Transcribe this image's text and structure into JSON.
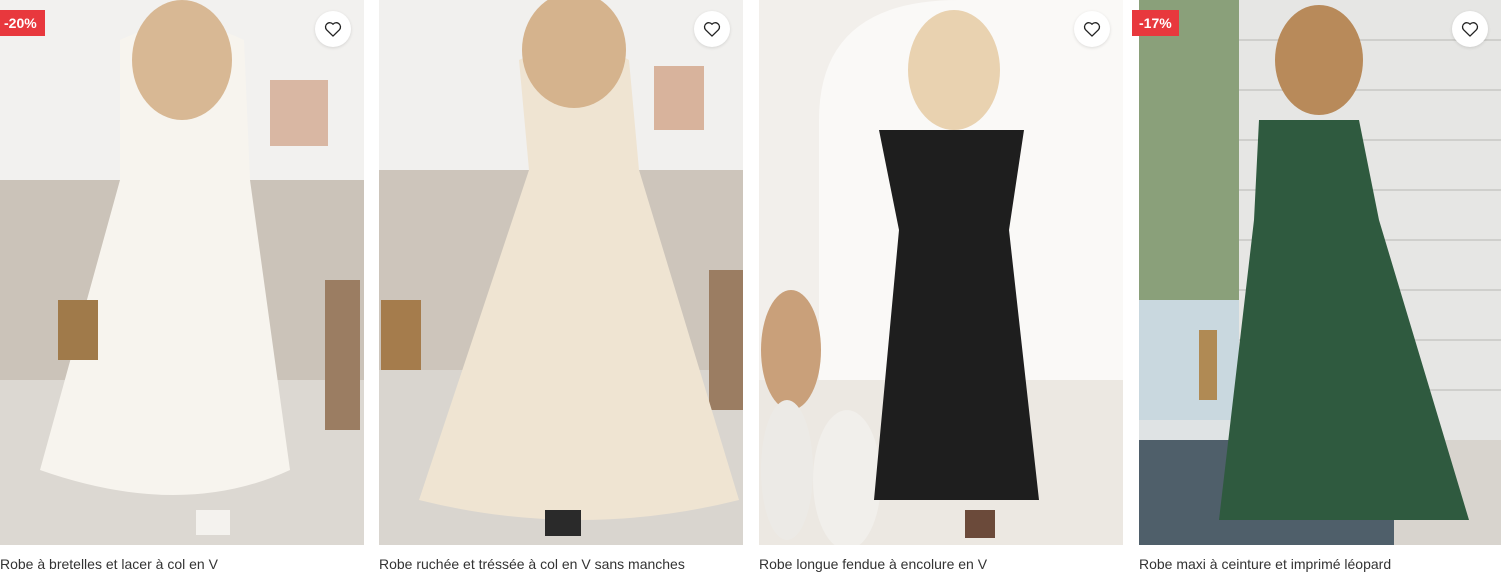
{
  "products": [
    {
      "title": "Robe à bretelles et lacer à col en V",
      "badge": "-20%",
      "wishlist_icon": "heart-outline-icon"
    },
    {
      "title": "Robe ruchée et tréssée à col en V sans manches",
      "badge": "",
      "wishlist_icon": "heart-outline-icon"
    },
    {
      "title": "Robe longue fendue à encolure en V",
      "badge": "",
      "wishlist_icon": "heart-outline-icon"
    },
    {
      "title": "Robe maxi à ceinture et imprimé léopard",
      "badge": "-17%",
      "wishlist_icon": "heart-outline-icon"
    }
  ],
  "colors": {
    "badge_bg": "#e8383d",
    "badge_text": "#ffffff",
    "title_text": "#333333"
  }
}
